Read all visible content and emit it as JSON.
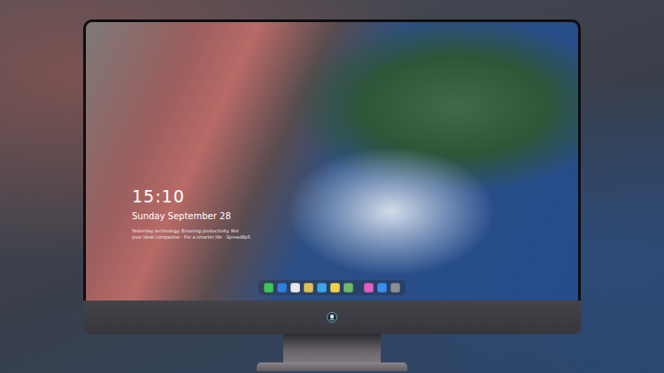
{
  "lock_screen": {
    "time": "15:10",
    "date": "Sunday September 28",
    "tagline": [
      "Yesterday technology. Ensuring productivity. Not",
      "your ideal companion · For a smarter life · Spread8p5"
    ]
  },
  "dock": {
    "groups": [
      [
        {
          "color": "#3ec45a"
        },
        {
          "color": "#2f7fe0"
        },
        {
          "color": "#e8e8ea"
        },
        {
          "color": "#d9c25a"
        },
        {
          "color": "#3aa6e8"
        },
        {
          "color": "#f2d24b"
        },
        {
          "color": "#6fb86a"
        }
      ],
      [
        {
          "color": "#e05fc0"
        },
        {
          "color": "#3a8ff0"
        },
        {
          "color": "#8a8d93"
        }
      ]
    ]
  }
}
